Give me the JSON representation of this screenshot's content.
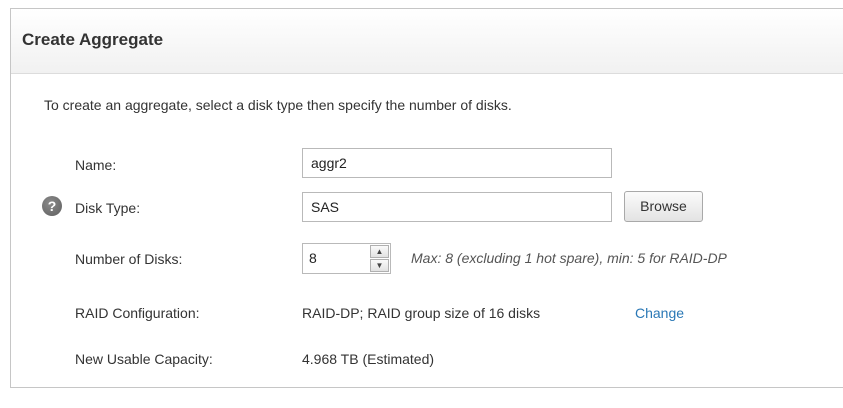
{
  "dialog": {
    "title": "Create Aggregate",
    "intro": "To create an aggregate, select a disk type then specify the number of disks."
  },
  "form": {
    "name": {
      "label": "Name:",
      "value": "aggr2"
    },
    "disk_type": {
      "label": "Disk Type:",
      "value": "SAS",
      "browse_label": "Browse",
      "help_glyph": "?"
    },
    "number_of_disks": {
      "label": "Number of Disks:",
      "value": "8",
      "hint": "Max: 8 (excluding 1 hot spare), min: 5 for RAID-DP"
    },
    "raid_configuration": {
      "label": "RAID Configuration:",
      "value": "RAID-DP; RAID group size of 16 disks",
      "change_label": "Change"
    },
    "usable_capacity": {
      "label": "New Usable Capacity:",
      "value": "4.968 TB (Estimated)"
    }
  },
  "icons": {
    "help": "help-question-icon",
    "spin_up": "triangle-up-icon",
    "spin_down": "triangle-down-icon"
  },
  "colors": {
    "link": "#2a78b6",
    "help_icon": "#6b6b6b"
  }
}
